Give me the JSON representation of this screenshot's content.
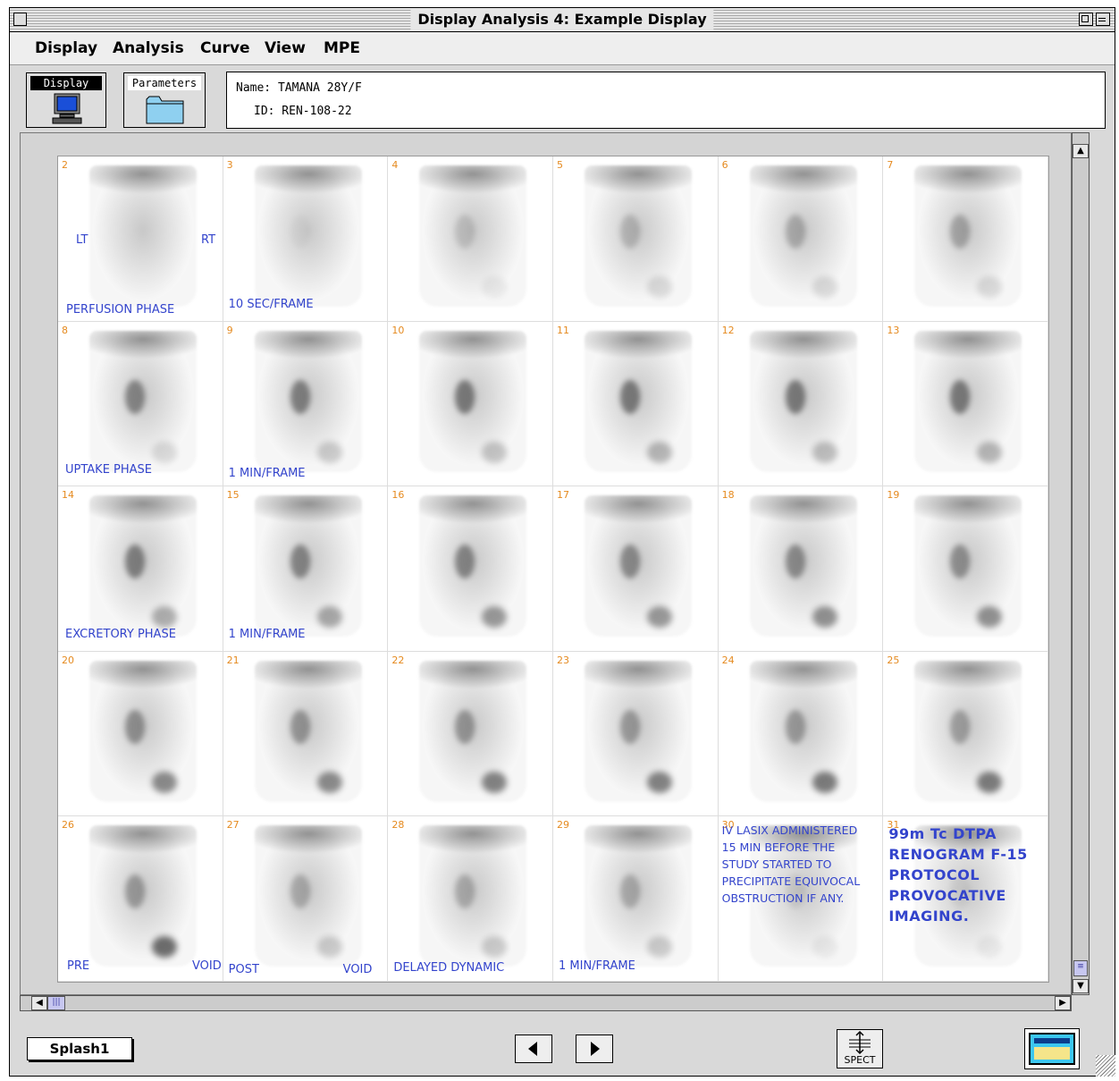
{
  "window": {
    "title": "Display Analysis 4: Example Display"
  },
  "menu": [
    "Display",
    "Analysis",
    "Curve",
    "View",
    "MPE"
  ],
  "toolbar": {
    "display_label": "Display",
    "parameters_label": "Parameters"
  },
  "patient": {
    "name_line": "Name: TAMANA 28Y/F",
    "id_line": "ID: REN-108-22"
  },
  "frames": [
    {
      "num": "2",
      "kidney": 0.0,
      "bladder": 0.0
    },
    {
      "num": "3",
      "kidney": 0.05,
      "bladder": 0.0
    },
    {
      "num": "4",
      "kidney": 0.25,
      "bladder": 0.1
    },
    {
      "num": "5",
      "kidney": 0.35,
      "bladder": 0.2
    },
    {
      "num": "6",
      "kidney": 0.45,
      "bladder": 0.2
    },
    {
      "num": "7",
      "kidney": 0.5,
      "bladder": 0.2
    },
    {
      "num": "8",
      "kidney": 0.8,
      "bladder": 0.2
    },
    {
      "num": "9",
      "kidney": 0.85,
      "bladder": 0.3
    },
    {
      "num": "10",
      "kidney": 0.9,
      "bladder": 0.35
    },
    {
      "num": "11",
      "kidney": 0.9,
      "bladder": 0.45
    },
    {
      "num": "12",
      "kidney": 0.9,
      "bladder": 0.4
    },
    {
      "num": "13",
      "kidney": 0.9,
      "bladder": 0.45
    },
    {
      "num": "14",
      "kidney": 0.85,
      "bladder": 0.5
    },
    {
      "num": "15",
      "kidney": 0.8,
      "bladder": 0.55
    },
    {
      "num": "16",
      "kidney": 0.8,
      "bladder": 0.65
    },
    {
      "num": "17",
      "kidney": 0.75,
      "bladder": 0.65
    },
    {
      "num": "18",
      "kidney": 0.75,
      "bladder": 0.7
    },
    {
      "num": "19",
      "kidney": 0.7,
      "bladder": 0.7
    },
    {
      "num": "20",
      "kidney": 0.7,
      "bladder": 0.75
    },
    {
      "num": "21",
      "kidney": 0.65,
      "bladder": 0.75
    },
    {
      "num": "22",
      "kidney": 0.65,
      "bladder": 0.8
    },
    {
      "num": "23",
      "kidney": 0.6,
      "bladder": 0.8
    },
    {
      "num": "24",
      "kidney": 0.6,
      "bladder": 0.85
    },
    {
      "num": "25",
      "kidney": 0.55,
      "bladder": 0.85
    },
    {
      "num": "26",
      "kidney": 0.6,
      "bladder": 0.95
    },
    {
      "num": "27",
      "kidney": 0.45,
      "bladder": 0.3
    },
    {
      "num": "28",
      "kidney": 0.45,
      "bladder": 0.3
    },
    {
      "num": "29",
      "kidney": 0.45,
      "bladder": 0.3
    },
    {
      "num": "30",
      "kidney": 0.15,
      "bladder": 0.1
    },
    {
      "num": "31",
      "kidney": 0.1,
      "bladder": 0.1
    }
  ],
  "annotations": {
    "lt": "LT",
    "rt": "RT",
    "perfusion": "PERFUSION PHASE",
    "sec_frame": "10 SEC/FRAME",
    "uptake": "UPTAKE PHASE",
    "min_frame_1": "1 MIN/FRAME",
    "excretory": "EXCRETORY PHASE",
    "min_frame_2": "1 MIN/FRAME",
    "pre": "PRE",
    "void_1": "VOID",
    "post": "POST",
    "void_2": "VOID",
    "delayed": "DELAYED  DYNAMIC",
    "min_frame_3": "1 MIN/FRAME",
    "lasix_note": "IV LASIX ADMINISTERED\n15 MIN BEFORE THE\nSTUDY STARTED TO\nPRECIPITATE EQUIVOCAL\nOBSTRUCTION IF ANY.",
    "protocol_note": "99m Tc DTPA\nRENOGRAM F-15\nPROTOCOL\nPROVOCATIVE\nIMAGING."
  },
  "bottom": {
    "splash_label": "Splash1",
    "spect_label": "SPECT"
  }
}
